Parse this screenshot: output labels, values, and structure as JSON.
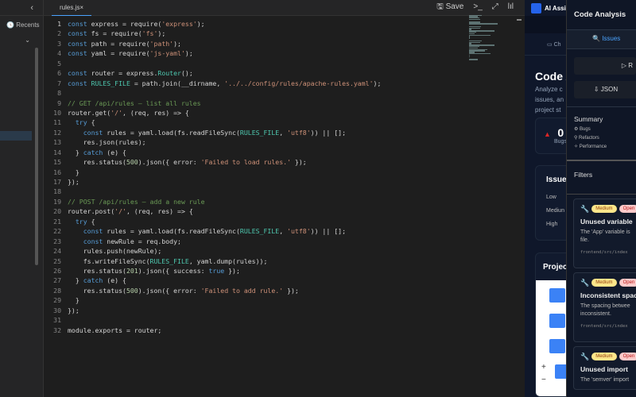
{
  "sidebar": {
    "collapse": "‹",
    "recents": "Recents",
    "chevron": "⌄"
  },
  "editor": {
    "tab": "rules.js",
    "close": "×",
    "save": "Save",
    "tools": [
      ">_",
      "⤢",
      "lıl"
    ],
    "lines": [
      [
        [
          "k",
          "const"
        ],
        [
          "p",
          " express = require("
        ],
        [
          "s",
          "'express'"
        ],
        [
          "p",
          ");"
        ]
      ],
      [
        [
          "k",
          "const"
        ],
        [
          "p",
          " fs = require("
        ],
        [
          "s",
          "'fs'"
        ],
        [
          "p",
          ");"
        ]
      ],
      [
        [
          "k",
          "const"
        ],
        [
          "p",
          " path = require("
        ],
        [
          "s",
          "'path'"
        ],
        [
          "p",
          ");"
        ]
      ],
      [
        [
          "k",
          "const"
        ],
        [
          "p",
          " yaml = require("
        ],
        [
          "s",
          "'js-yaml'"
        ],
        [
          "p",
          ");"
        ]
      ],
      [],
      [
        [
          "k",
          "const"
        ],
        [
          "p",
          " router = express."
        ],
        [
          "t",
          "Router"
        ],
        [
          "p",
          "();"
        ]
      ],
      [
        [
          "k",
          "const"
        ],
        [
          "p",
          " "
        ],
        [
          "t",
          "RULES_FILE"
        ],
        [
          "p",
          " = path.join(__dirname, "
        ],
        [
          "s",
          "'../../config/rules/apache-rules.yaml'"
        ],
        [
          "p",
          ");"
        ]
      ],
      [],
      [
        [
          "c",
          "// GET /api/rules — list all rules"
        ]
      ],
      [
        [
          "p",
          "router.get("
        ],
        [
          "s",
          "'/'"
        ],
        [
          "p",
          ", (req, res) => {"
        ]
      ],
      [
        [
          "p",
          "  "
        ],
        [
          "k",
          "try"
        ],
        [
          "p",
          " {"
        ]
      ],
      [
        [
          "p",
          "    "
        ],
        [
          "k",
          "const"
        ],
        [
          "p",
          " rules = yaml.load(fs.readFileSync("
        ],
        [
          "t",
          "RULES_FILE"
        ],
        [
          "p",
          ", "
        ],
        [
          "s",
          "'utf8'"
        ],
        [
          "p",
          ")) || [];"
        ]
      ],
      [
        [
          "p",
          "    res.json(rules);"
        ]
      ],
      [
        [
          "p",
          "  } "
        ],
        [
          "k",
          "catch"
        ],
        [
          "p",
          " (e) {"
        ]
      ],
      [
        [
          "p",
          "    res.status("
        ],
        [
          "num",
          "500"
        ],
        [
          "p",
          ").json({ error: "
        ],
        [
          "s",
          "'Failed to load rules.'"
        ],
        [
          "p",
          " });"
        ]
      ],
      [
        [
          "p",
          "  }"
        ]
      ],
      [
        [
          "p",
          "});"
        ]
      ],
      [],
      [
        [
          "c",
          "// POST /api/rules — add a new rule"
        ]
      ],
      [
        [
          "p",
          "router.post("
        ],
        [
          "s",
          "'/'"
        ],
        [
          "p",
          ", (req, res) => {"
        ]
      ],
      [
        [
          "p",
          "  "
        ],
        [
          "k",
          "try"
        ],
        [
          "p",
          " {"
        ]
      ],
      [
        [
          "p",
          "    "
        ],
        [
          "k",
          "const"
        ],
        [
          "p",
          " rules = yaml.load(fs.readFileSync("
        ],
        [
          "t",
          "RULES_FILE"
        ],
        [
          "p",
          ", "
        ],
        [
          "s",
          "'utf8'"
        ],
        [
          "p",
          ")) || [];"
        ]
      ],
      [
        [
          "p",
          "    "
        ],
        [
          "k",
          "const"
        ],
        [
          "p",
          " newRule = req.body;"
        ]
      ],
      [
        [
          "p",
          "    rules.push(newRule);"
        ]
      ],
      [
        [
          "p",
          "    fs.writeFileSync("
        ],
        [
          "t",
          "RULES_FILE"
        ],
        [
          "p",
          ", yaml.dump(rules));"
        ]
      ],
      [
        [
          "p",
          "    res.status("
        ],
        [
          "num",
          "201"
        ],
        [
          "p",
          ").json({ success: "
        ],
        [
          "k",
          "true"
        ],
        [
          "p",
          " });"
        ]
      ],
      [
        [
          "p",
          "  } "
        ],
        [
          "k",
          "catch"
        ],
        [
          "p",
          " (e) {"
        ]
      ],
      [
        [
          "p",
          "    res.status("
        ],
        [
          "num",
          "500"
        ],
        [
          "p",
          ").json({ error: "
        ],
        [
          "s",
          "'Failed to add rule.'"
        ],
        [
          "p",
          " });"
        ]
      ],
      [
        [
          "p",
          "  }"
        ]
      ],
      [
        [
          "p",
          "});"
        ]
      ],
      [],
      [
        [
          "p",
          "module.exports = router;"
        ]
      ]
    ]
  },
  "assistant": {
    "title": "AI Assi",
    "chat_tab": "Ch",
    "heading": "Code A",
    "desc": [
      "Analyze c",
      "issues, an",
      "project st"
    ],
    "bug_count": "0",
    "bug_label": "Bugs",
    "issues_card": "Issue",
    "levels": [
      "Low",
      "Mediun",
      "High"
    ],
    "project_card": "Projec",
    "zoom_in": "+",
    "zoom_out": "−"
  },
  "panel": {
    "title": "Code Analysis",
    "tab": "Issues",
    "run": "▷ R",
    "json": "⇩ JSON",
    "summary_title": "Summary",
    "summary": [
      "⚙ Bugs",
      "⚲ Refactors",
      "✧ Performance"
    ],
    "filters": "Filters",
    "issues": [
      {
        "severity": "Medium",
        "status": "Open",
        "title": "Unused variable",
        "desc": "The 'App' variable is file.",
        "path": "frontend/src/index"
      },
      {
        "severity": "Medium",
        "status": "Open",
        "title": "Inconsistent spac",
        "desc": "The spacing betwee inconsistent.",
        "path": "frontend/src/index"
      },
      {
        "severity": "Medium",
        "status": "Open",
        "title": "Unused import",
        "desc": "The 'semver' import",
        "path": ""
      }
    ]
  }
}
